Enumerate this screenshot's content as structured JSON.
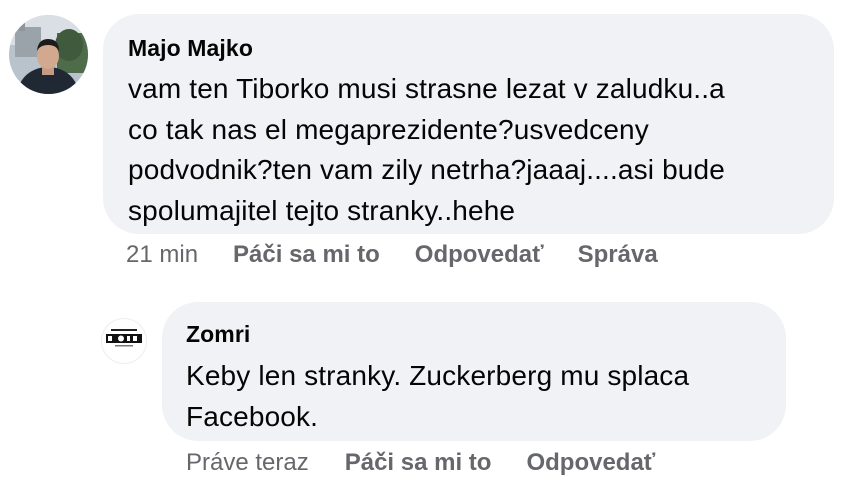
{
  "comments": [
    {
      "author": "Majo Majko",
      "text": "vam ten Tiborko musi strasne lezat v zaludku..a\nco tak nas el megaprezidente?usvedceny\npodvodnik?ten vam zily netrha?jaaaj....asi bude\nspolumajitel tejto stranky..hehe",
      "time": "21 min",
      "actions": [
        "Páči sa mi to",
        "Odpovedať",
        "Správa"
      ]
    },
    {
      "author": "Zomri",
      "text": "Keby len stranky. Zuckerberg mu splaca\nFacebook.",
      "time": "Práve teraz",
      "actions": [
        "Páči sa mi to",
        "Odpovedať"
      ],
      "avatar_logo": "KEEP CALM AND ZOMRI"
    }
  ],
  "colors": {
    "bubble": "#f0f2f5",
    "meta": "#65676b",
    "text": "#050505"
  }
}
